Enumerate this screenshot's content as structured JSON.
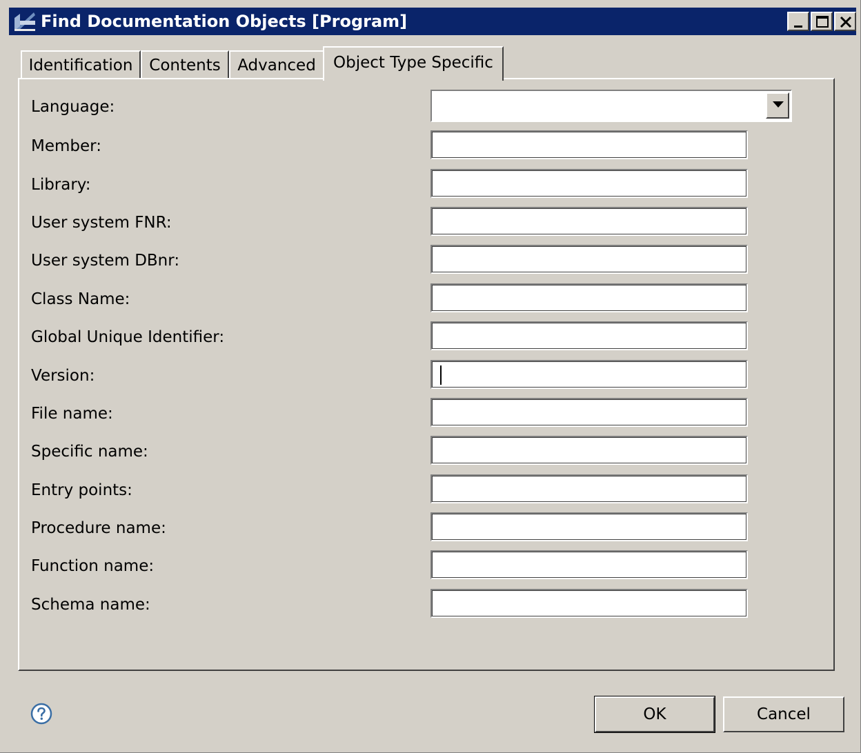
{
  "window": {
    "title": "Find Documentation Objects [Program]",
    "icon": "wizard-icon",
    "controls": {
      "minimize": "minimize-icon",
      "maximize": "maximize-icon",
      "close": "close-icon"
    }
  },
  "tabs": [
    {
      "label": "Identification",
      "active": false
    },
    {
      "label": "Contents",
      "active": false
    },
    {
      "label": "Advanced",
      "active": false
    },
    {
      "label": "Object Type Specific",
      "active": true
    }
  ],
  "form": {
    "language": {
      "label": "Language:",
      "value": ""
    },
    "fields": [
      {
        "label": "Member:",
        "value": ""
      },
      {
        "label": "Library:",
        "value": ""
      },
      {
        "label": "User system FNR:",
        "value": ""
      },
      {
        "label": "User system DBnr:",
        "value": ""
      },
      {
        "label": "Class Name:",
        "value": ""
      },
      {
        "label": "Global Unique Identifier:",
        "value": ""
      },
      {
        "label": "Version:",
        "value": ""
      },
      {
        "label": "File name:",
        "value": ""
      },
      {
        "label": "Specific name:",
        "value": ""
      },
      {
        "label": "Entry points:",
        "value": ""
      },
      {
        "label": "Procedure name:",
        "value": ""
      },
      {
        "label": "Function name:",
        "value": ""
      },
      {
        "label": "Schema name:",
        "value": ""
      }
    ]
  },
  "footer": {
    "help_icon": "help-icon",
    "ok_label": "OK",
    "cancel_label": "Cancel"
  },
  "colors": {
    "titlebar": "#0a246a",
    "face": "#d4d0c8"
  }
}
